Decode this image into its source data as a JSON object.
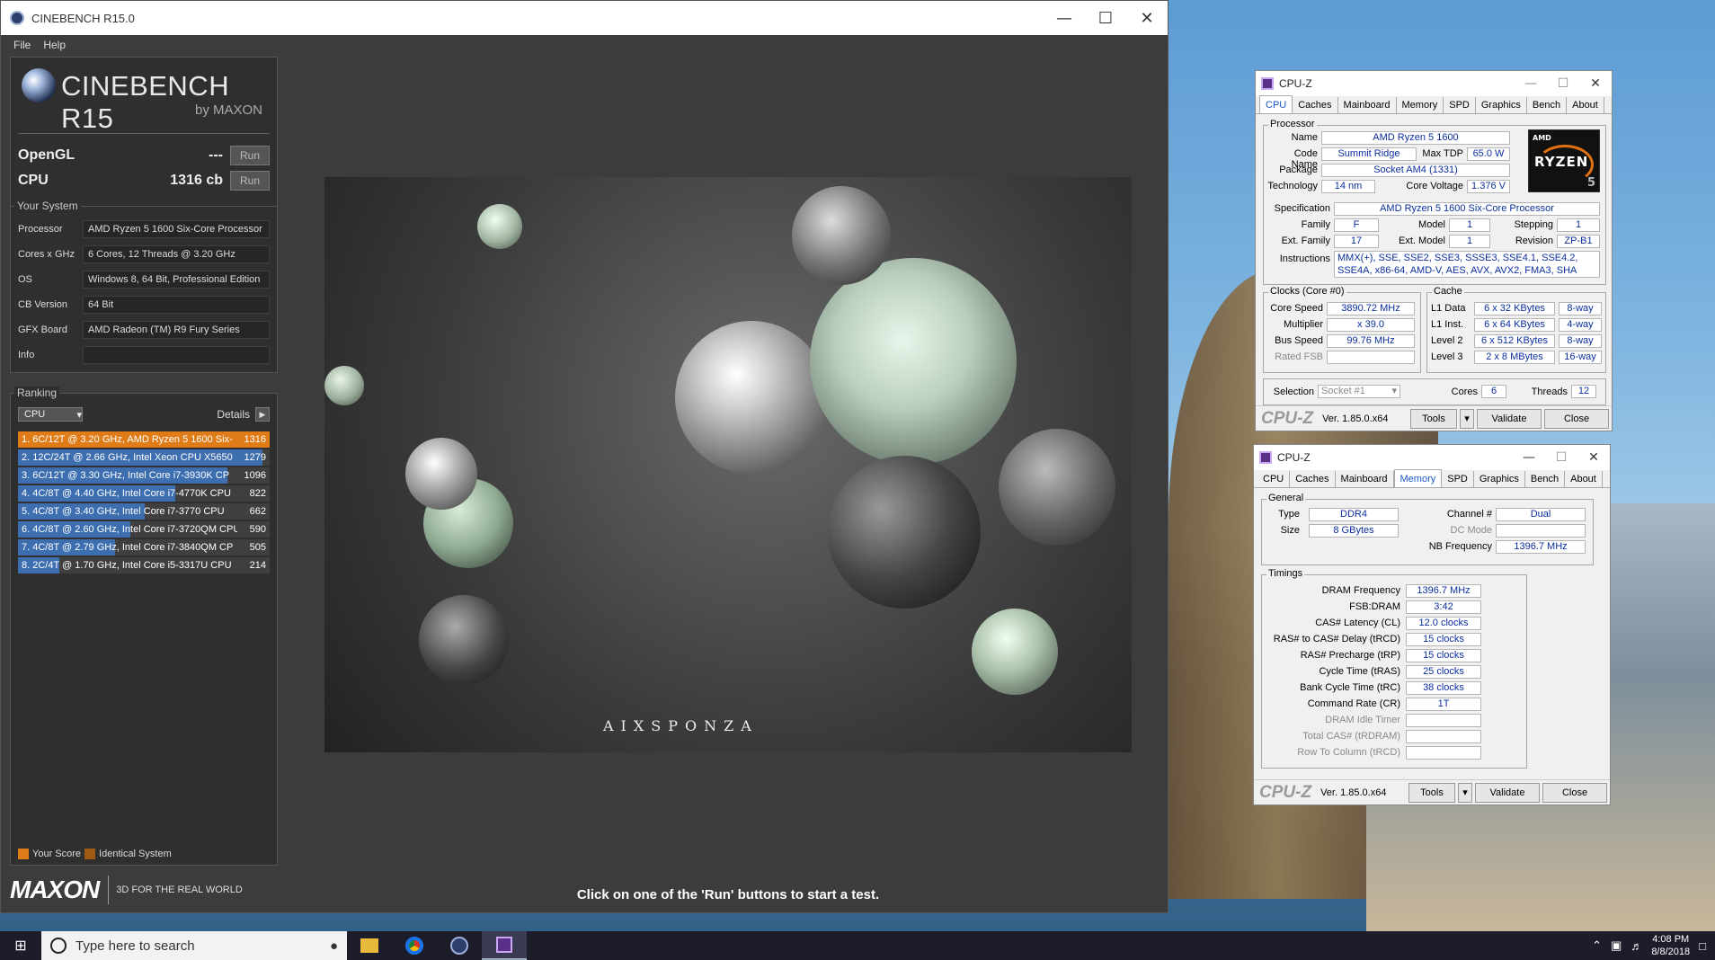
{
  "cinebench": {
    "title": "CINEBENCH R15.0",
    "menu": [
      "File",
      "Help"
    ],
    "brand": "CINEBENCH R15",
    "by": "by MAXON",
    "opengl": {
      "label": "OpenGL",
      "value": "---",
      "run": "Run"
    },
    "cpu": {
      "label": "CPU",
      "value": "1316 cb",
      "run": "Run"
    },
    "your_system": {
      "title": "Your System",
      "rows": [
        {
          "k": "Processor",
          "v": "AMD Ryzen 5 1600 Six-Core Processor"
        },
        {
          "k": "Cores x GHz",
          "v": "6 Cores, 12 Threads @ 3.20 GHz"
        },
        {
          "k": "OS",
          "v": "Windows 8, 64 Bit, Professional Edition"
        },
        {
          "k": "CB Version",
          "v": "64 Bit"
        },
        {
          "k": "GFX Board",
          "v": "AMD Radeon (TM) R9 Fury Series"
        },
        {
          "k": "Info",
          "v": ""
        }
      ]
    },
    "ranking": {
      "title": "Ranking",
      "select": "CPU",
      "details": "Details",
      "rows": [
        {
          "text": "1. 6C/12T @ 3.20 GHz, AMD Ryzen 5 1600 Six-",
          "score": "1316",
          "frac": 1.0,
          "me": true
        },
        {
          "text": "2. 12C/24T @ 2.66 GHz, Intel Xeon CPU X5650",
          "score": "1279",
          "frac": 0.972,
          "me": false
        },
        {
          "text": "3. 6C/12T @ 3.30 GHz,  Intel Core i7-3930K CP",
          "score": "1096",
          "frac": 0.833,
          "me": false
        },
        {
          "text": "4. 4C/8T @ 4.40 GHz, Intel Core i7-4770K CPU",
          "score": "822",
          "frac": 0.625,
          "me": false
        },
        {
          "text": "5. 4C/8T @ 3.40 GHz,  Intel Core i7-3770 CPU",
          "score": "662",
          "frac": 0.503,
          "me": false
        },
        {
          "text": "6. 4C/8T @ 2.60 GHz, Intel Core i7-3720QM CPU",
          "score": "590",
          "frac": 0.448,
          "me": false
        },
        {
          "text": "7. 4C/8T @ 2.79 GHz,  Intel Core i7-3840QM CP",
          "score": "505",
          "frac": 0.384,
          "me": false
        },
        {
          "text": "8. 2C/4T @ 1.70 GHz,  Intel Core i5-3317U CPU",
          "score": "214",
          "frac": 0.163,
          "me": false
        }
      ],
      "legend": {
        "your_score": "Your Score",
        "identical": "Identical System"
      }
    },
    "maxon": "MAXON",
    "tagline": "3D FOR THE REAL WORLD",
    "watermark": "AIXSPONZA",
    "status": "Click on one of the 'Run' buttons to start a test."
  },
  "cpuz1": {
    "title": "CPU-Z",
    "tabs": [
      "CPU",
      "Caches",
      "Mainboard",
      "Memory",
      "SPD",
      "Graphics",
      "Bench",
      "About"
    ],
    "active_tab": "CPU",
    "processor": {
      "title": "Processor",
      "name_l": "Name",
      "name": "AMD Ryzen 5 1600",
      "code_l": "Code Name",
      "code": "Summit Ridge",
      "tdp_l": "Max TDP",
      "tdp": "65.0 W",
      "package_l": "Package",
      "package": "Socket AM4 (1331)",
      "tech_l": "Technology",
      "tech": "14 nm",
      "volt_l": "Core Voltage",
      "volt": "1.376 V",
      "spec_l": "Specification",
      "spec": "AMD Ryzen 5 1600 Six-Core Processor",
      "family_l": "Family",
      "family": "F",
      "model_l": "Model",
      "model": "1",
      "stepping_l": "Stepping",
      "stepping": "1",
      "extfam_l": "Ext. Family",
      "extfam": "17",
      "extmod_l": "Ext. Model",
      "extmod": "1",
      "rev_l": "Revision",
      "rev": "ZP-B1",
      "instr_l": "Instructions",
      "instr": "MMX(+), SSE, SSE2, SSE3, SSSE3, SSE4.1, SSE4.2, SSE4A, x86-64, AMD-V, AES, AVX, AVX2, FMA3, SHA"
    },
    "logo": {
      "amd": "AMD",
      "ryzen": "RYZEN",
      "num": "5"
    },
    "clocks": {
      "title": "Clocks (Core #0)",
      "speed_l": "Core Speed",
      "speed": "3890.72 MHz",
      "mult_l": "Multiplier",
      "mult": "x 39.0",
      "bus_l": "Bus Speed",
      "bus": "99.76 MHz",
      "fsb_l": "Rated FSB",
      "fsb": ""
    },
    "cache": {
      "title": "Cache",
      "rows": [
        {
          "k": "L1 Data",
          "v": "6 x 32 KBytes",
          "w": "8-way"
        },
        {
          "k": "L1 Inst.",
          "v": "6 x 64 KBytes",
          "w": "4-way"
        },
        {
          "k": "Level 2",
          "v": "6 x 512 KBytes",
          "w": "8-way"
        },
        {
          "k": "Level 3",
          "v": "2 x 8 MBytes",
          "w": "16-way"
        }
      ]
    },
    "selection_l": "Selection",
    "selection": "Socket #1",
    "cores_l": "Cores",
    "cores": "6",
    "threads_l": "Threads",
    "threads": "12",
    "footer": {
      "logo": "CPU-Z",
      "ver": "Ver. 1.85.0.x64",
      "tools": "Tools",
      "validate": "Validate",
      "close": "Close"
    }
  },
  "cpuz2": {
    "title": "CPU-Z",
    "tabs": [
      "CPU",
      "Caches",
      "Mainboard",
      "Memory",
      "SPD",
      "Graphics",
      "Bench",
      "About"
    ],
    "active_tab": "Memory",
    "general": {
      "title": "General",
      "type_l": "Type",
      "type": "DDR4",
      "size_l": "Size",
      "size": "8 GBytes",
      "channel_l": "Channel #",
      "channel": "Dual",
      "dc_l": "DC Mode",
      "dc": "",
      "nb_l": "NB Frequency",
      "nb": "1396.7 MHz"
    },
    "timings": {
      "title": "Timings",
      "rows": [
        {
          "k": "DRAM Frequency",
          "v": "1396.7 MHz",
          "dim": false
        },
        {
          "k": "FSB:DRAM",
          "v": "3:42",
          "dim": false
        },
        {
          "k": "CAS# Latency (CL)",
          "v": "12.0 clocks",
          "dim": false
        },
        {
          "k": "RAS# to CAS# Delay (tRCD)",
          "v": "15 clocks",
          "dim": false
        },
        {
          "k": "RAS# Precharge (tRP)",
          "v": "15 clocks",
          "dim": false
        },
        {
          "k": "Cycle Time (tRAS)",
          "v": "25 clocks",
          "dim": false
        },
        {
          "k": "Bank Cycle Time (tRC)",
          "v": "38 clocks",
          "dim": false
        },
        {
          "k": "Command Rate (CR)",
          "v": "1T",
          "dim": false
        },
        {
          "k": "DRAM Idle Timer",
          "v": "",
          "dim": true
        },
        {
          "k": "Total CAS# (tRDRAM)",
          "v": "",
          "dim": true
        },
        {
          "k": "Row To Column (tRCD)",
          "v": "",
          "dim": true
        }
      ]
    },
    "footer": {
      "logo": "CPU-Z",
      "ver": "Ver. 1.85.0.x64",
      "tools": "Tools",
      "validate": "Validate",
      "close": "Close"
    }
  },
  "taskbar": {
    "search_placeholder": "Type here to search",
    "time": "4:08 PM",
    "date": "8/8/2018"
  }
}
